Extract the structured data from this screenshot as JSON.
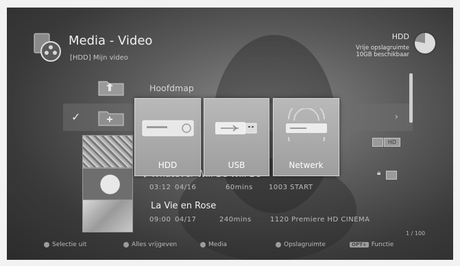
{
  "header": {
    "title": "Media - Video",
    "subtitle": "[HDD] Mijn video",
    "storage_label": "HDD",
    "storage_line1": "Vrije opslagruimte",
    "storage_line2": "10GB beschikbaar",
    "storage_free_fraction": 0.78
  },
  "list": {
    "root_folder_label": "Hoofdmap",
    "items": [
      {
        "title": "Whatever Will Be Will Be",
        "time": "03:12",
        "date": "04/16",
        "duration": "60mins",
        "channel": "1003 START"
      },
      {
        "title": "La Vie en Rose",
        "time": "09:00",
        "date": "04/17",
        "duration": "240mins",
        "channel": "1120 Premiere HD CINEMA"
      }
    ],
    "hd_badge": "HD"
  },
  "popup": {
    "options": [
      {
        "label": "HDD",
        "icon": "hdd-icon"
      },
      {
        "label": "USB",
        "icon": "usb-icon"
      },
      {
        "label": "Netwerk",
        "icon": "network-icon"
      }
    ]
  },
  "footer": {
    "select_out": "Selectie uit",
    "release_all": "Alles vrijgeven",
    "media": "Media",
    "storage": "Opslagruimte",
    "opt_badge": "OPT+",
    "function": "Functie",
    "page": "1 / 100"
  },
  "colors": {
    "tile_bg": "#a9a9a9",
    "selection_bar": "#6e6e6e"
  }
}
